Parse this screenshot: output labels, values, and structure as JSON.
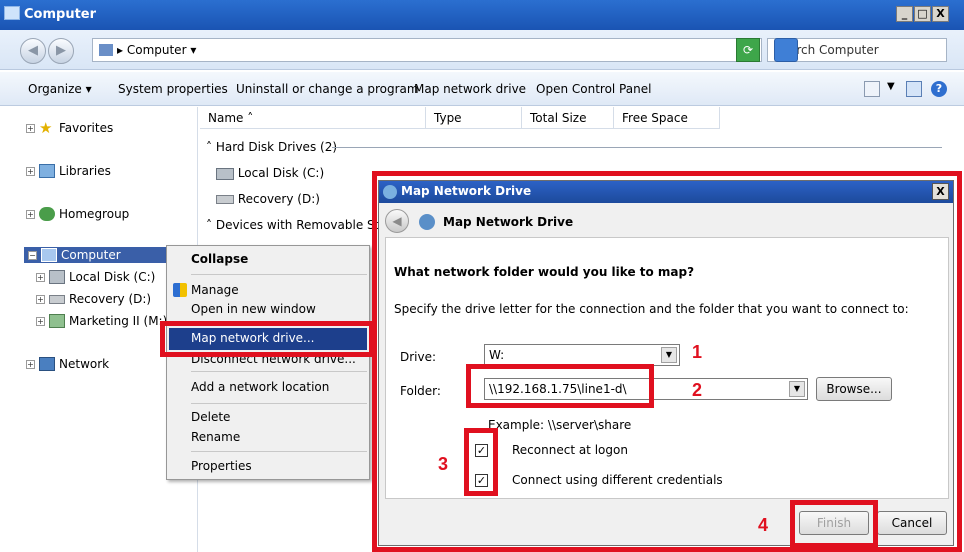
{
  "window": {
    "title": "Computer",
    "minimize": "_",
    "maximize": "□",
    "close": "X"
  },
  "address": {
    "crumb": "Computer",
    "search_placeholder": "Search Computer"
  },
  "toolbar": {
    "organize": "Organize",
    "system_properties": "System properties",
    "uninstall": "Uninstall or change a program",
    "map_network": "Map network drive",
    "open_control_panel": "Open Control Panel"
  },
  "nav": {
    "favorites": "Favorites",
    "libraries": "Libraries",
    "homegroup": "Homegroup",
    "computer": "Computer",
    "local_disk": "Local Disk (C:)",
    "recovery": "Recovery (D:)",
    "marketing": "Marketing II (M:)",
    "network": "Network"
  },
  "columns": {
    "name": "Name",
    "type": "Type",
    "total_size": "Total Size",
    "free_space": "Free Space"
  },
  "content": {
    "group_hdd": "Hard Disk Drives (2)",
    "drive_c": "Local Disk (C:)",
    "drive_d": "Recovery (D:)",
    "group_removable": "Devices with Removable Sto"
  },
  "context_menu": {
    "collapse": "Collapse",
    "manage": "Manage",
    "open_new_window": "Open in new window",
    "map_network_drive": "Map network drive...",
    "disconnect": "Disconnect network drive...",
    "add_location": "Add a network location",
    "delete": "Delete",
    "rename": "Rename",
    "properties": "Properties"
  },
  "dialog": {
    "title": "Map Network Drive",
    "header": "Map Network Drive",
    "question": "What network folder would you like to map?",
    "instruction": "Specify the drive letter for the connection and the folder that you want to connect to:",
    "drive_label": "Drive:",
    "drive_value": "W:",
    "folder_label": "Folder:",
    "folder_value": "\\\\192.168.1.75\\line1-d\\",
    "browse": "Browse...",
    "example": "Example: \\\\server\\share",
    "reconnect": "Reconnect at logon",
    "different_creds": "Connect using different credentials",
    "finish": "Finish",
    "cancel": "Cancel"
  },
  "annotations": [
    "1",
    "2",
    "3",
    "4"
  ],
  "colors": {
    "highlight_red": "#e0101f",
    "title_blue": "#1a54b3"
  }
}
